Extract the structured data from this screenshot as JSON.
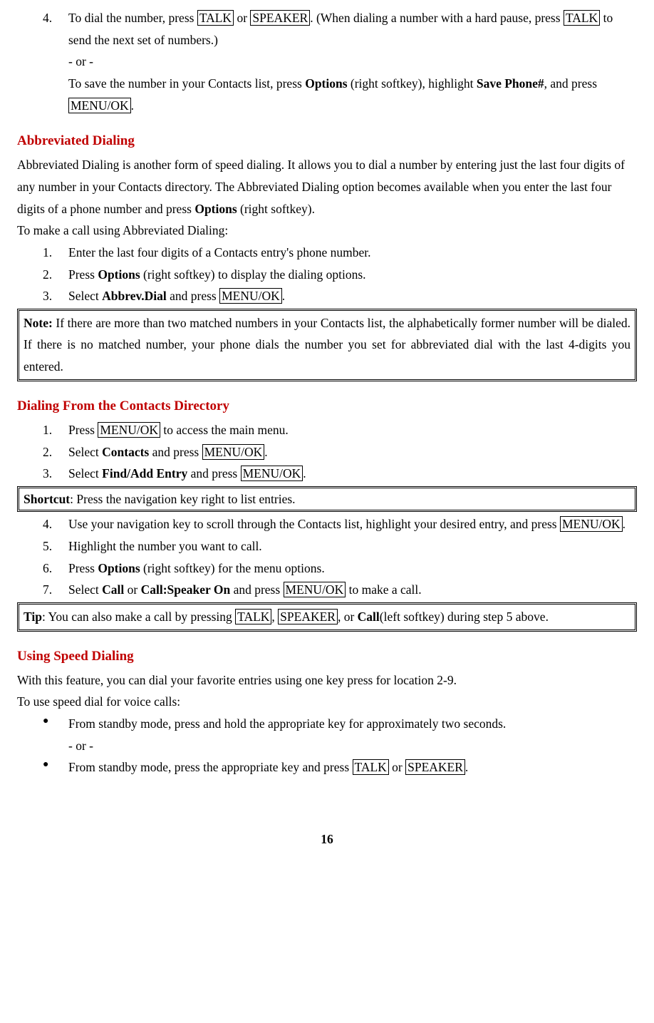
{
  "s0": {
    "item4": {
      "num": "4.",
      "line1a": "To dial the number, press ",
      "key_talk": "TALK",
      "line1b": " or ",
      "key_speaker": "SPEAKER",
      "line1c": ". (When dialing a number with a hard pause, press ",
      "key_talk2": "TALK",
      "line1d": " to send the next set of numbers.)",
      "or": "- or -",
      "line2a": "To save the number in your Contacts list, press ",
      "bold_options": "Options",
      "line2b": " (right softkey), highlight ",
      "bold_save": "Save Phone#",
      "line2c": ", and press ",
      "key_menuok": "MENU/OK",
      "line2d": "."
    }
  },
  "s1": {
    "heading": "Abbreviated Dialing",
    "p1a": "Abbreviated Dialing is another form of speed dialing. It allows you to dial a number by entering just the last four digits of any number in your Contacts directory. The Abbreviated Dialing option becomes available when you enter the last four digits of a phone number and press ",
    "p1_bold": "Options",
    "p1b": " (right softkey).",
    "p2": "To make a call using Abbreviated Dialing:",
    "i1_num": "1.",
    "i1_txt": "Enter the last four digits of a Contacts entry's phone number.",
    "i2": {
      "num": "2.",
      "a": "Press ",
      "bold": "Options",
      "b": " (right softkey) to display the dialing options."
    },
    "i3": {
      "num": "3.",
      "a": "Select ",
      "bold": "Abbrev.Dial",
      "b": " and press ",
      "key": "MENU/OK",
      "c": "."
    },
    "note": {
      "label": "Note:",
      "txt": " If there are more than two matched numbers in your Contacts list, the alphabetically former number will be dialed. If there is no matched number, your phone dials the number you set for abbreviated dial with the last 4-digits you entered."
    }
  },
  "s2": {
    "heading": "Dialing From the Contacts Directory",
    "i1": {
      "num": "1.",
      "a": "Press ",
      "key": "MENU/OK",
      "b": " to access the main menu."
    },
    "i2": {
      "num": "2.",
      "a": "Select ",
      "bold": "Contacts",
      "b": " and press ",
      "key": "MENU/OK",
      "c": "."
    },
    "i3": {
      "num": "3.",
      "a": "Select ",
      "bold": "Find/Add Entry",
      "b": " and press ",
      "key": "MENU/OK",
      "c": "."
    },
    "shortcut": {
      "label": "Shortcut",
      "txt": ": Press the navigation key right to list entries."
    },
    "i4": {
      "num": "4.",
      "a": "Use your navigation key to scroll through the Contacts list, highlight your desired entry, and press ",
      "key": "MENU/OK",
      "b": "."
    },
    "i5": {
      "num": "5.",
      "txt": "Highlight the number you want to call."
    },
    "i6": {
      "num": "6.",
      "a": "Press ",
      "bold": "Options",
      "b": " (right softkey) for the menu options."
    },
    "i7": {
      "num": "7.",
      "a": "Select ",
      "bold1": "Call",
      "b": " or ",
      "bold2": "Call:Speaker On",
      "c": " and press ",
      "key": "MENU/OK",
      "d": " to make a call."
    },
    "tip": {
      "label": "Tip",
      "a": ": You can also make a call by pressing ",
      "k1": "TALK",
      "b": ", ",
      "k2": "SPEAKER",
      "c": ", or ",
      "bold": "Call",
      "d": "(left softkey) during step 5 above."
    }
  },
  "s3": {
    "heading": "Using Speed Dialing",
    "p1": "With this feature, you can dial your favorite entries using one key press for location 2-9.",
    "p2": "To use speed dial for voice calls:",
    "b1": {
      "txt": "From standby mode, press and hold the appropriate key for approximately two seconds.",
      "or": "- or -"
    },
    "b2": {
      "a": "From standby mode, press the appropriate key and press ",
      "k1": "TALK",
      "b": " or ",
      "k2": "SPEAKER",
      "c": "."
    }
  },
  "pagenum": "16"
}
